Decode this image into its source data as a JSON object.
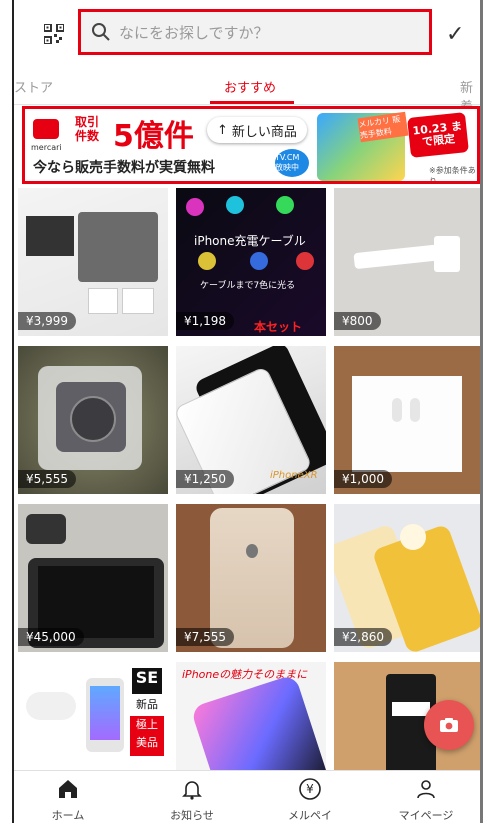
{
  "header": {
    "search_placeholder": "なにをお探しですか？",
    "qr_icon": "qr-code-icon",
    "right_icon": "checkmark-icon"
  },
  "tabs": [
    {
      "label": "ストア"
    },
    {
      "label": "おすすめ"
    },
    {
      "label": "新着"
    }
  ],
  "banner": {
    "line1": "取引",
    "line2": "件数",
    "big": "5億件",
    "bottom": "今なら販売手数料が実質無料",
    "logo_text": "mercari",
    "pill": "新しい商品",
    "tvcm": "TV.CM 放映中",
    "badge": "メルカリ 販売手数料",
    "date": "10.23 まで限定",
    "cond": "※参加条件あり"
  },
  "items": [
    {
      "price": "¥3,999",
      "overlay": ""
    },
    {
      "price": "¥1,198",
      "overlay": "iPhone充電ケーブル",
      "overlay2": "ケーブルまで7色に光る",
      "overlay3": "本セット"
    },
    {
      "price": "¥800",
      "overlay": ""
    },
    {
      "price": "¥5,555",
      "overlay": ""
    },
    {
      "price": "¥1,250",
      "overlay": "iPhoneXR"
    },
    {
      "price": "¥1,000",
      "overlay": ""
    },
    {
      "price": "¥45,000",
      "overlay": ""
    },
    {
      "price": "¥7,555",
      "overlay": ""
    },
    {
      "price": "¥2,860",
      "overlay": ""
    },
    {
      "price": "",
      "overlay": "SE"
    },
    {
      "price": "",
      "overlay": "iPhoneの魅力そのままに"
    },
    {
      "price": "",
      "overlay": ""
    }
  ],
  "extra_labels": {
    "se_badge": "SE",
    "se_text1": "新品",
    "se_text2": "極上",
    "se_text3": "美品"
  },
  "nav": [
    {
      "label": "ホーム",
      "icon": "home-icon"
    },
    {
      "label": "お知らせ",
      "icon": "bell-icon"
    },
    {
      "label": "メルペイ",
      "icon": "yen-icon"
    },
    {
      "label": "マイページ",
      "icon": "person-icon"
    }
  ],
  "colors": {
    "accent": "#e60012",
    "fab": "#e85454"
  }
}
